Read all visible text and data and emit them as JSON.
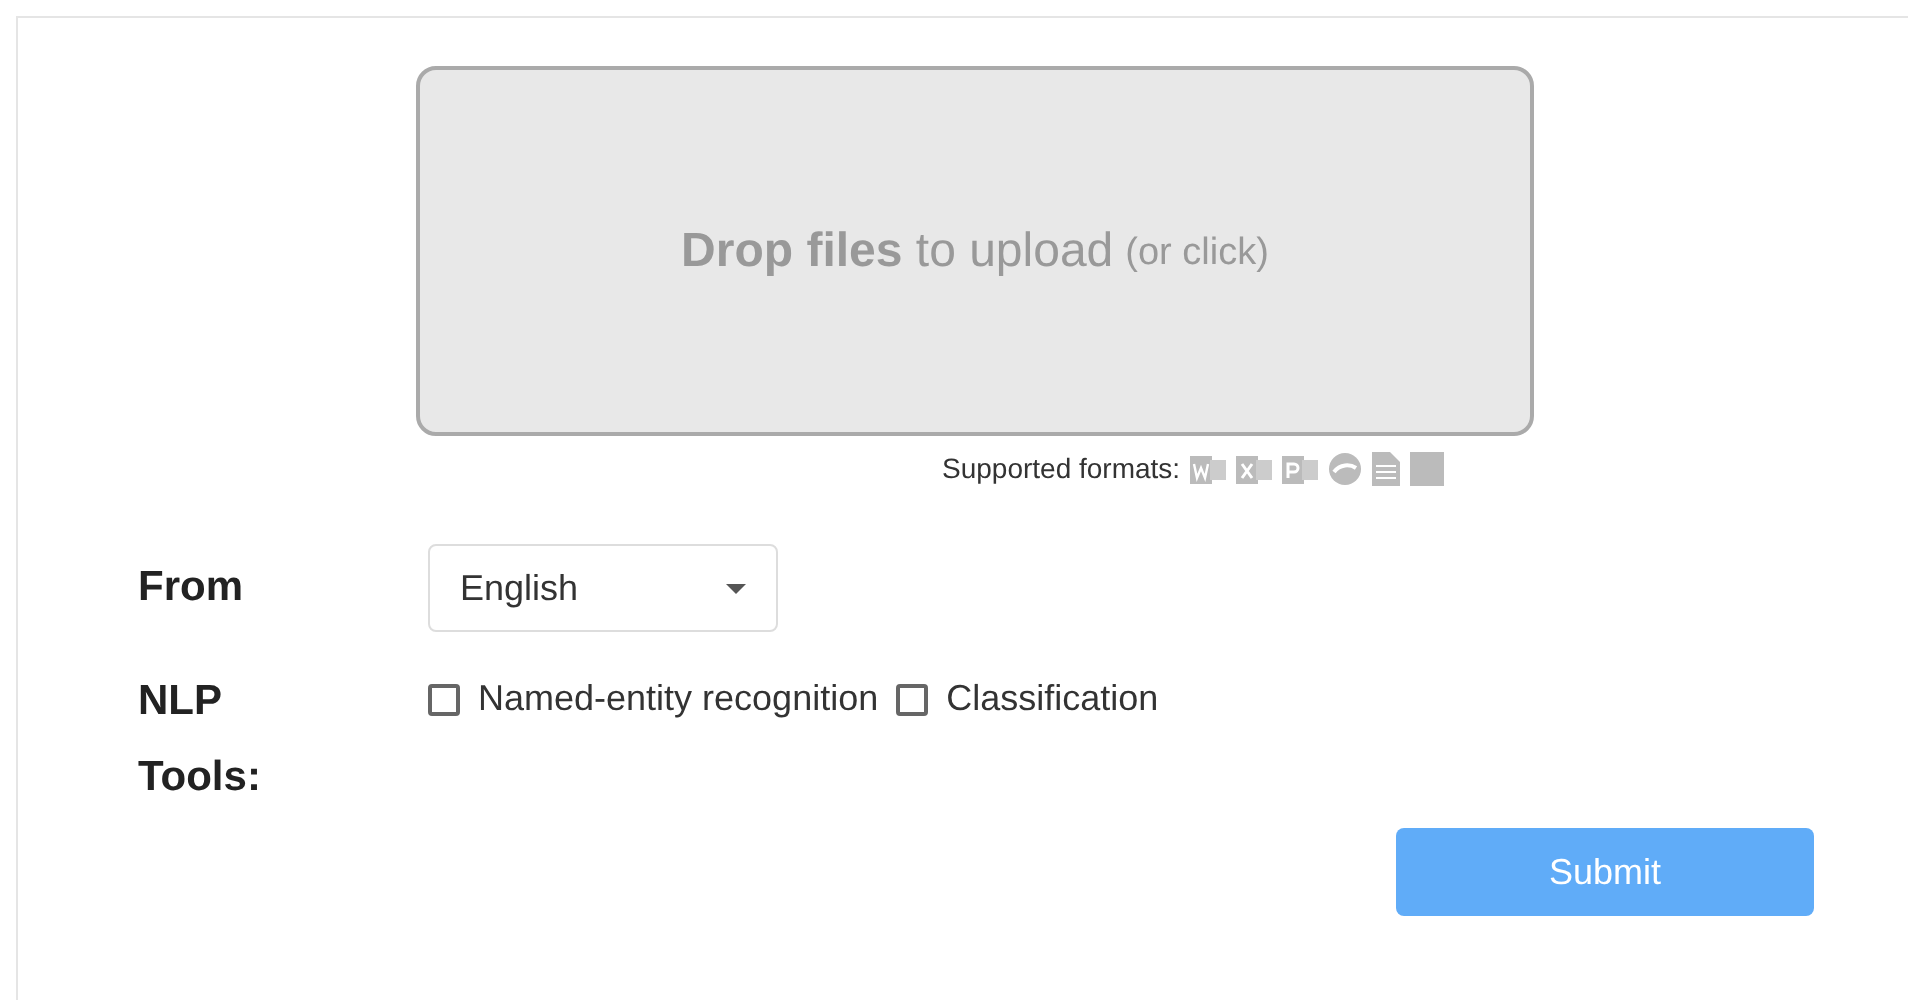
{
  "dropzone": {
    "text": "**Drop files** to upload",
    "hint": "(or click)"
  },
  "formats": {
    "label": "Supported formats:"
  },
  "from": {
    "label": "From",
    "value": "English"
  },
  "nlp_tools": {
    "label": "NLP Tools:",
    "options": [
      {
        "label": "Named-entity recognition",
        "checked": false
      },
      {
        "label": "Classification",
        "checked": false
      }
    ]
  },
  "submit": {
    "label": "Submit"
  }
}
